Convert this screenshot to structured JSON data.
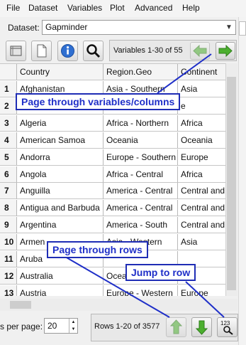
{
  "menubar": {
    "items": [
      "File",
      "Dataset",
      "Variables",
      "Plot",
      "Advanced",
      "Help"
    ]
  },
  "dataset": {
    "label": "Dataset:",
    "value": "Gapminder"
  },
  "toolbar": {
    "icons": [
      "data-grid-icon",
      "new-document-icon",
      "info-icon",
      "search-icon"
    ],
    "variables_range": "Variables 1-30 of 55"
  },
  "grid": {
    "columns": [
      "Country",
      "Region.Geo",
      "Continent"
    ],
    "rows": [
      {
        "num": "1",
        "cells": [
          "Afghanistan",
          "Asia - Southern",
          "Asia"
        ]
      },
      {
        "num": "2",
        "cells": [
          "",
          "",
          "e"
        ]
      },
      {
        "num": "3",
        "cells": [
          "Algeria",
          "Africa - Northern",
          "Africa"
        ]
      },
      {
        "num": "4",
        "cells": [
          "American Samoa",
          "Oceania",
          "Oceania"
        ]
      },
      {
        "num": "5",
        "cells": [
          "Andorra",
          "Europe - Southern",
          "Europe"
        ]
      },
      {
        "num": "6",
        "cells": [
          "Angola",
          "Africa - Central",
          "Africa"
        ]
      },
      {
        "num": "7",
        "cells": [
          "Anguilla",
          "America - Central",
          "Central and"
        ]
      },
      {
        "num": "8",
        "cells": [
          "Antigua and Barbuda",
          "America - Central",
          "Central and"
        ]
      },
      {
        "num": "9",
        "cells": [
          "Argentina",
          "America - South",
          "Central and"
        ]
      },
      {
        "num": "10",
        "cells": [
          "Armen",
          "Asia - Western",
          "Asia"
        ]
      },
      {
        "num": "11",
        "cells": [
          "Aruba",
          "",
          ""
        ]
      },
      {
        "num": "12",
        "cells": [
          "Australia",
          "Ocea",
          ""
        ]
      },
      {
        "num": "13",
        "cells": [
          "Austria",
          "Europe - Western",
          "Europe"
        ]
      }
    ]
  },
  "footer": {
    "rows_per_page_label": "s per page:",
    "rows_per_page_value": "20",
    "rows_range": "Rows 1-20 of 3577"
  },
  "annotations": {
    "page_variables": "Page through variables/columns",
    "page_rows": "Page through rows",
    "jump_to_row": "Jump to row"
  },
  "colors": {
    "annotation": "#1f2fc8",
    "nav_arrow": "#3a9a2a"
  }
}
